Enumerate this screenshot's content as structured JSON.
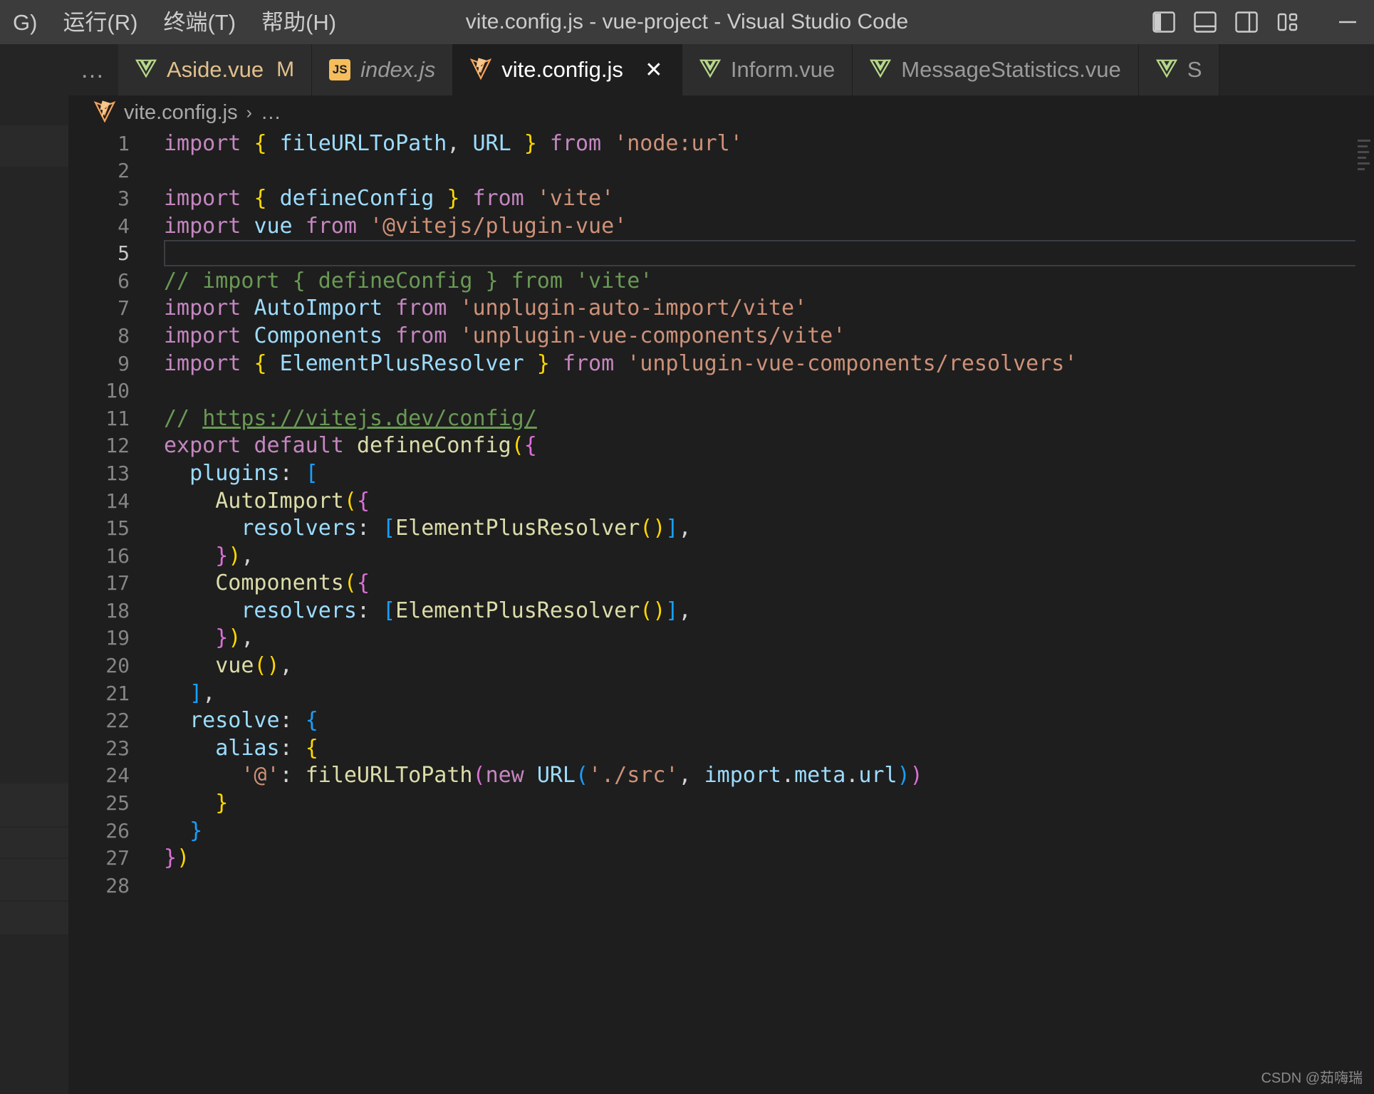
{
  "window": {
    "title": "vite.config.js - vue-project - Visual Studio Code",
    "menus": [
      {
        "label": "G)",
        "name": "menu-debug-partial"
      },
      {
        "label": "运行(R)",
        "name": "menu-run"
      },
      {
        "label": "终端(T)",
        "name": "menu-terminal"
      },
      {
        "label": "帮助(H)",
        "name": "menu-help"
      }
    ],
    "actions": [
      {
        "name": "toggle-primary-sidebar-icon",
        "title": "切换主侧栏"
      },
      {
        "name": "toggle-panel-icon",
        "title": "切换面板"
      },
      {
        "name": "toggle-secondary-sidebar-icon",
        "title": "切换辅助侧栏"
      },
      {
        "name": "customize-layout-icon",
        "title": "自定义布局"
      },
      {
        "name": "minimize-window-icon",
        "title": "最小化"
      }
    ]
  },
  "tabbar": {
    "overflow_label": "…",
    "tabs": [
      {
        "label": "Aside.vue",
        "icon": "vue-icon",
        "state": "modified",
        "dirty_marker": "M",
        "active": false,
        "italic": false
      },
      {
        "label": "index.js",
        "icon": "js-icon",
        "state": "preview",
        "dirty_marker": "",
        "active": false,
        "italic": true
      },
      {
        "label": "vite.config.js",
        "icon": "vite-icon",
        "state": "active",
        "dirty_marker": "",
        "active": true,
        "italic": false,
        "close_label": "✕"
      },
      {
        "label": "Inform.vue",
        "icon": "vue-icon",
        "state": "inactive",
        "dirty_marker": "",
        "active": false,
        "italic": false
      },
      {
        "label": "MessageStatistics.vue",
        "icon": "vue-icon",
        "state": "inactive",
        "dirty_marker": "",
        "active": false,
        "italic": false
      },
      {
        "label": "S",
        "icon": "vue-icon",
        "state": "inactive",
        "dirty_marker": "",
        "active": false,
        "italic": false
      }
    ]
  },
  "breadcrumb": {
    "file": "vite.config.js",
    "separator": "›",
    "more": "…"
  },
  "editor": {
    "filename": "vite.config.js",
    "current_line": 5,
    "first_line": 1,
    "last_line": 28,
    "lines": [
      {
        "n": "1",
        "text": "import { fileURLToPath, URL } from 'node:url'"
      },
      {
        "n": "2",
        "text": ""
      },
      {
        "n": "3",
        "text": "import { defineConfig } from 'vite'"
      },
      {
        "n": "4",
        "text": "import vue from '@vitejs/plugin-vue'"
      },
      {
        "n": "5",
        "text": ""
      },
      {
        "n": "6",
        "text": "// import { defineConfig } from 'vite'"
      },
      {
        "n": "7",
        "text": "import AutoImport from 'unplugin-auto-import/vite'"
      },
      {
        "n": "8",
        "text": "import Components from 'unplugin-vue-components/vite'"
      },
      {
        "n": "9",
        "text": "import { ElementPlusResolver } from 'unplugin-vue-components/resolvers'"
      },
      {
        "n": "10",
        "text": ""
      },
      {
        "n": "11",
        "text": "// https://vitejs.dev/config/"
      },
      {
        "n": "12",
        "text": "export default defineConfig({"
      },
      {
        "n": "13",
        "text": "  plugins: ["
      },
      {
        "n": "14",
        "text": "    AutoImport({"
      },
      {
        "n": "15",
        "text": "      resolvers: [ElementPlusResolver()],"
      },
      {
        "n": "16",
        "text": "    }),"
      },
      {
        "n": "17",
        "text": "    Components({"
      },
      {
        "n": "18",
        "text": "      resolvers: [ElementPlusResolver()],"
      },
      {
        "n": "19",
        "text": "    }),"
      },
      {
        "n": "20",
        "text": "    vue(),"
      },
      {
        "n": "21",
        "text": "  ],"
      },
      {
        "n": "22",
        "text": "  resolve: {"
      },
      {
        "n": "23",
        "text": "    alias: {"
      },
      {
        "n": "24",
        "text": "      '@': fileURLToPath(new URL('./src', import.meta.url))"
      },
      {
        "n": "25",
        "text": "    }"
      },
      {
        "n": "26",
        "text": "  }"
      },
      {
        "n": "27",
        "text": "})"
      },
      {
        "n": "28",
        "text": ""
      }
    ]
  },
  "watermark": {
    "text": "CSDN @茹嗨瑞"
  },
  "colors": {
    "titlebar_bg": "#3c3c3c",
    "editor_bg": "#1e1e1e",
    "tab_inactive_bg": "#2d2d2d",
    "keyword": "#c586c0",
    "identifier": "#9cdcfe",
    "function": "#dcdcaa",
    "string": "#ce9178",
    "comment": "#6a9955",
    "bracket1": "#ffd700",
    "bracket2": "#da70d6",
    "bracket3": "#179fff",
    "modified_tab": "#e2c08d",
    "line_number": "#858585"
  }
}
